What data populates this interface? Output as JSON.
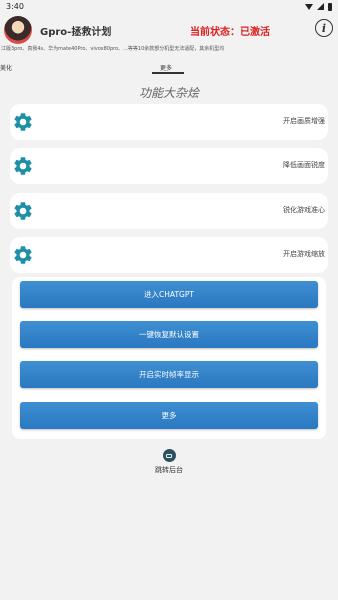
{
  "status_bar": {
    "time": "3:40"
  },
  "header": {
    "app_title": "Gpro-拯救计划",
    "activation_status": "当前状态：已激活",
    "info_icon_glyph": "i"
  },
  "ticker": "江版3pro、真我4s、华为mate40Pro、vivox80pro、...等等10余款部分机型无法适配，其余机型均",
  "tabs": [
    {
      "label": "美化"
    },
    {
      "label": "更多"
    }
  ],
  "main": {
    "section_title": "功能大杂烩",
    "features": [
      {
        "icon": "gear-icon",
        "label": "开启画质增强"
      },
      {
        "icon": "gear-icon",
        "label": "降低画面锐度"
      },
      {
        "icon": "gear-icon",
        "label": "锐化游戏准心"
      },
      {
        "icon": "gear-icon",
        "label": "开启游戏缩放"
      }
    ],
    "buttons": [
      {
        "label": "进入CHATGPT"
      },
      {
        "label": "一键恢复默认设置"
      },
      {
        "label": "开启实时帧率显示"
      },
      {
        "label": "更多"
      }
    ]
  },
  "footer": {
    "background_label": "跳转后台"
  },
  "colors": {
    "accent": "#2a78c0",
    "status_red": "#e02020",
    "gear_teal": "#1e8fa6",
    "background": "#f2f2f2"
  }
}
